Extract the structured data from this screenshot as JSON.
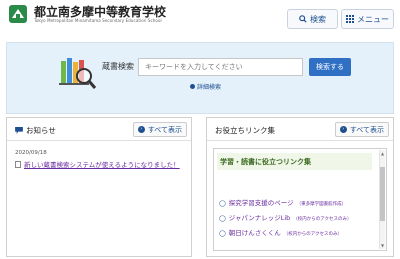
{
  "header": {
    "school_name": "都立南多摩中等教育学校",
    "school_sub": "Tokyo Metropolitan Minamitama Secondary Education School",
    "search_label": "検索",
    "menu_label": "メニュー"
  },
  "search": {
    "label": "蔵書検索",
    "placeholder": "キーワードを入力してください",
    "button": "検索する",
    "detail_link": "詳細検索"
  },
  "news": {
    "title": "お知らせ",
    "show_all": "すべて表示",
    "date": "2020/09/18",
    "item": "新しい蔵書検索システムが使えるようになりました！"
  },
  "links": {
    "title": "お役立ちリンク集",
    "show_all": "すべて表示",
    "heading": "学習・読書に役立つリンク集",
    "items": [
      {
        "label": "探究学習支援のページ",
        "note": "（東多摩学図書館作成）"
      },
      {
        "label": "ジャパンナレッジLib",
        "note": "（校内からのアクセスのみ）"
      },
      {
        "label": "朝日けんさくくん",
        "note": "（校内からのアクセスのみ）"
      }
    ]
  },
  "colors": {
    "accent": "#2f6fc4",
    "link": "#6a2ca0",
    "panel_bg": "#e4f1fa"
  }
}
